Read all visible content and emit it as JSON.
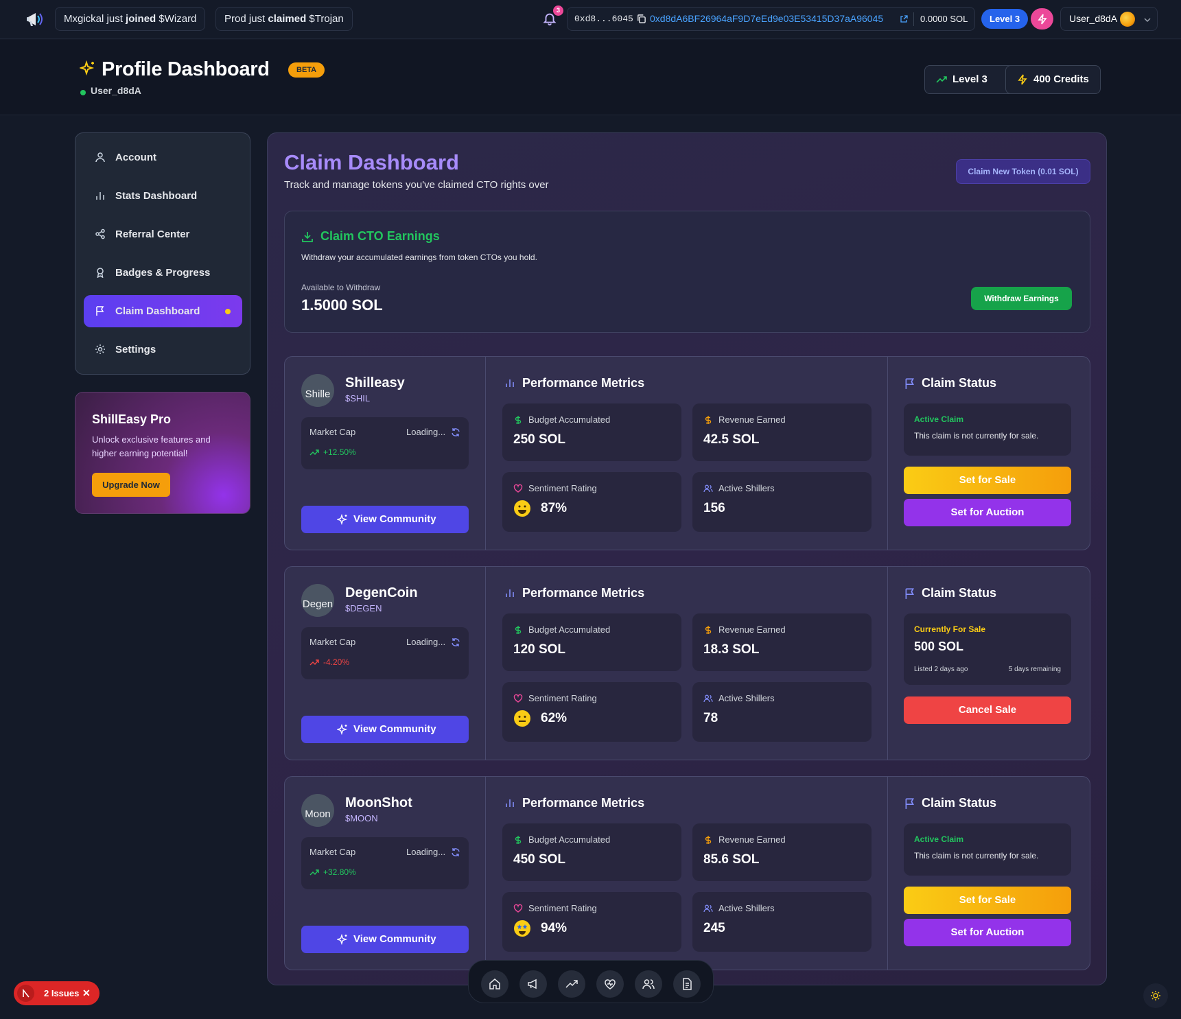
{
  "topbar": {
    "tickers": [
      {
        "user": "Mxgickal",
        "verb": "joined",
        "token": "$Wizard"
      },
      {
        "user": "Prod",
        "verb": "claimed",
        "token": "$Trojan"
      }
    ],
    "ticker_just": "just",
    "notification_count": "3",
    "wallet_short": "0xd8...6045",
    "wallet_full": "0xd8dA6BF26964aF9D7eEd9e03E53415D37aA96045",
    "sol_balance": "0.0000 SOL",
    "level_pill": "Level 3",
    "username": "User_d8dA"
  },
  "header": {
    "title": "Profile Dashboard",
    "badge": "BETA",
    "username": "User_d8dA",
    "level_button": "Level 3",
    "credits_button": "400 Credits"
  },
  "sidebar": {
    "items": [
      {
        "label": "Account",
        "icon": "user-icon"
      },
      {
        "label": "Stats Dashboard",
        "icon": "bar-chart-icon"
      },
      {
        "label": "Referral Center",
        "icon": "share-icon"
      },
      {
        "label": "Badges & Progress",
        "icon": "award-icon"
      },
      {
        "label": "Claim Dashboard",
        "icon": "flag-icon",
        "active": true
      },
      {
        "label": "Settings",
        "icon": "gear-icon"
      }
    ]
  },
  "pro": {
    "title": "ShillEasy Pro",
    "text": "Unlock exclusive features and higher earning potential!",
    "button": "Upgrade Now"
  },
  "main": {
    "title": "Claim Dashboard",
    "subtitle": "Track and manage tokens you've claimed CTO rights over",
    "claim_new_button": "Claim New Token (0.01 SOL)"
  },
  "earnings": {
    "title": "Claim CTO Earnings",
    "description": "Withdraw your accumulated earnings from token CTOs you hold.",
    "available_label": "Available to Withdraw",
    "amount": "1.5000 SOL",
    "button": "Withdraw Earnings"
  },
  "labels": {
    "market_cap": "Market Cap",
    "loading": "Loading...",
    "view_community": "View Community",
    "performance_metrics": "Performance Metrics",
    "budget": "Budget Accumulated",
    "revenue": "Revenue Earned",
    "sentiment": "Sentiment Rating",
    "shillers": "Active Shillers",
    "claim_status": "Claim Status",
    "set_for_sale": "Set for Sale",
    "set_for_auction": "Set for Auction",
    "cancel_sale": "Cancel Sale",
    "active_claim": "Active Claim",
    "not_for_sale": "This claim is not currently for sale.",
    "currently_for_sale": "Currently For Sale"
  },
  "tokens": [
    {
      "name": "Shilleasy",
      "symbol": "$SHIL",
      "avatar_alt": "Shille",
      "change": "+12.50%",
      "change_dir": "up",
      "budget": "250 SOL",
      "revenue": "42.5 SOL",
      "sentiment": "87%",
      "sentiment_face": "happy",
      "shillers": "156",
      "status": "active"
    },
    {
      "name": "DegenCoin",
      "symbol": "$DEGEN",
      "avatar_alt": "Degen",
      "change": "-4.20%",
      "change_dir": "down",
      "budget": "120 SOL",
      "revenue": "18.3 SOL",
      "sentiment": "62%",
      "sentiment_face": "neutral",
      "shillers": "78",
      "status": "sale",
      "sale_price": "500 SOL",
      "listed": "Listed 2 days ago",
      "remaining": "5 days remaining"
    },
    {
      "name": "MoonShot",
      "symbol": "$MOON",
      "avatar_alt": "Moon",
      "change": "+32.80%",
      "change_dir": "up",
      "budget": "450 SOL",
      "revenue": "85.6 SOL",
      "sentiment": "94%",
      "sentiment_face": "star-struck",
      "shillers": "245",
      "status": "active"
    }
  ],
  "dock": [
    "home-icon",
    "megaphone-icon",
    "trending-icon",
    "heart-icon",
    "users-icon",
    "document-icon"
  ],
  "issues": {
    "label": "2 Issues",
    "initial": "N"
  },
  "colors": {
    "accent": "#7c3aed",
    "green": "#22c55e",
    "red": "#ef4444",
    "amber": "#f59e0b",
    "pink": "#ec4899",
    "blue": "#2563eb"
  }
}
